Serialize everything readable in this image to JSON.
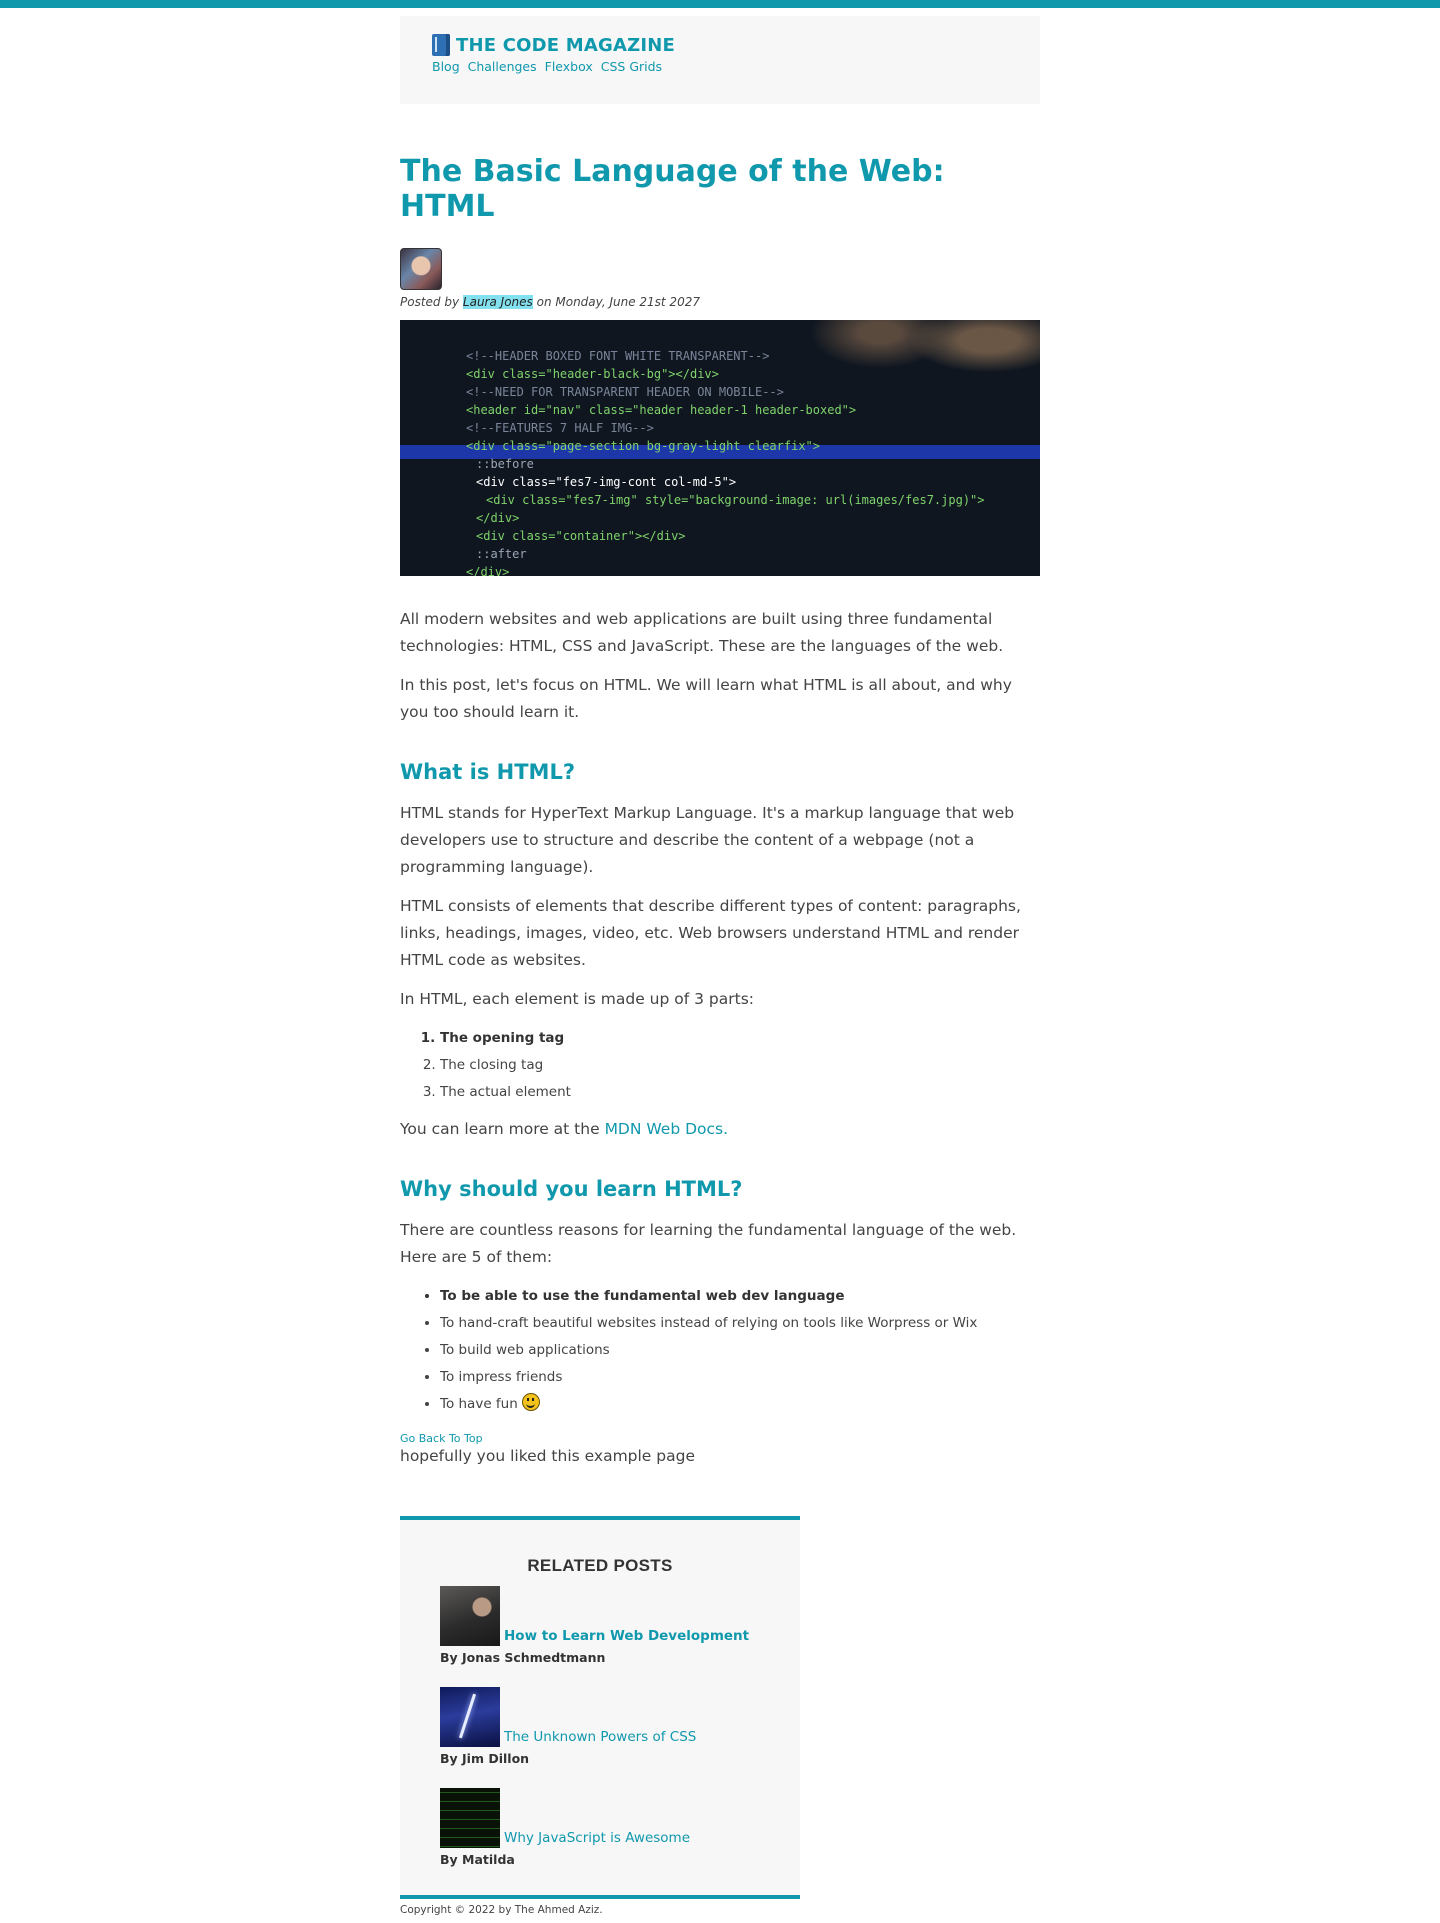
{
  "header": {
    "brand": "THE CODE MAGAZINE",
    "nav": [
      "Blog",
      "Challenges",
      "Flexbox",
      "CSS Grids"
    ]
  },
  "article": {
    "title": "The Basic Language of the Web: HTML",
    "byline": {
      "prefix": "Posted by",
      "author": "Laura Jones",
      "date": "on Monday, June 21st 2027"
    },
    "intro": [
      "All modern websites and web applications are built using three fundamental technologies: HTML, CSS and JavaScript. These are the languages of the web.",
      "In this post, let's focus on HTML. We will learn what HTML is all about, and why you too should learn it."
    ],
    "section1": {
      "heading": "What is HTML?",
      "paragraphs": [
        "HTML stands for HyperText Markup Language. It's a markup language that web developers use to structure and describe the content of a webpage (not a programming language).",
        "HTML consists of elements that describe different types of content: paragraphs, links, headings, images, video, etc. Web browsers understand HTML and render HTML code as websites.",
        "In HTML, each element is made up of 3 parts:"
      ],
      "parts": [
        "The opening tag",
        "The closing tag",
        "The actual element"
      ],
      "learn_more_prefix": "You can learn more at the",
      "learn_more_link": "MDN Web Docs."
    },
    "section2": {
      "heading": "Why should you learn HTML?",
      "intro": "There are countless reasons for learning the fundamental language of the web. Here are 5 of them:",
      "reasons": [
        "To be able to use the fundamental web dev language",
        "To hand-craft beautiful websites instead of relying on tools like Worpress or Wix",
        "To build web applications",
        "To impress friends",
        "To have fun"
      ]
    },
    "back_to_top": "Go Back To Top",
    "closing": "hopefully you liked this example page"
  },
  "hero_code": [
    "<!--HEADER BOXED FONT WHITE TRANSPARENT-->",
    "<div class=\"header-black-bg\"></div>",
    "<!--NEED FOR TRANSPARENT HEADER ON MOBILE-->",
    "<header id=\"nav\" class=\"header header-1 header-boxed\">",
    "<!--FEATURES 7 HALF IMG-->",
    "<div class=\"page-section bg-gray-light clearfix\">",
    "::before",
    "<div class=\"fes7-img-cont col-md-5\">",
    "<div class=\"fes7-img\" style=\"background-image: url(images/fes7.jpg)\">",
    "</div>",
    "<div class=\"container\"></div>",
    "::after",
    "</div>"
  ],
  "related": {
    "heading": "RELATED POSTS",
    "posts": [
      {
        "title": "How to Learn Web Development",
        "author": "By Jonas Schmedtmann"
      },
      {
        "title": "The Unknown Powers of CSS",
        "author": "By Jim Dillon"
      },
      {
        "title": "Why JavaScript is Awesome",
        "author": "By Matilda"
      }
    ]
  },
  "footer": {
    "copyright": "Copyright © 2022 by The Ahmed Aziz."
  }
}
